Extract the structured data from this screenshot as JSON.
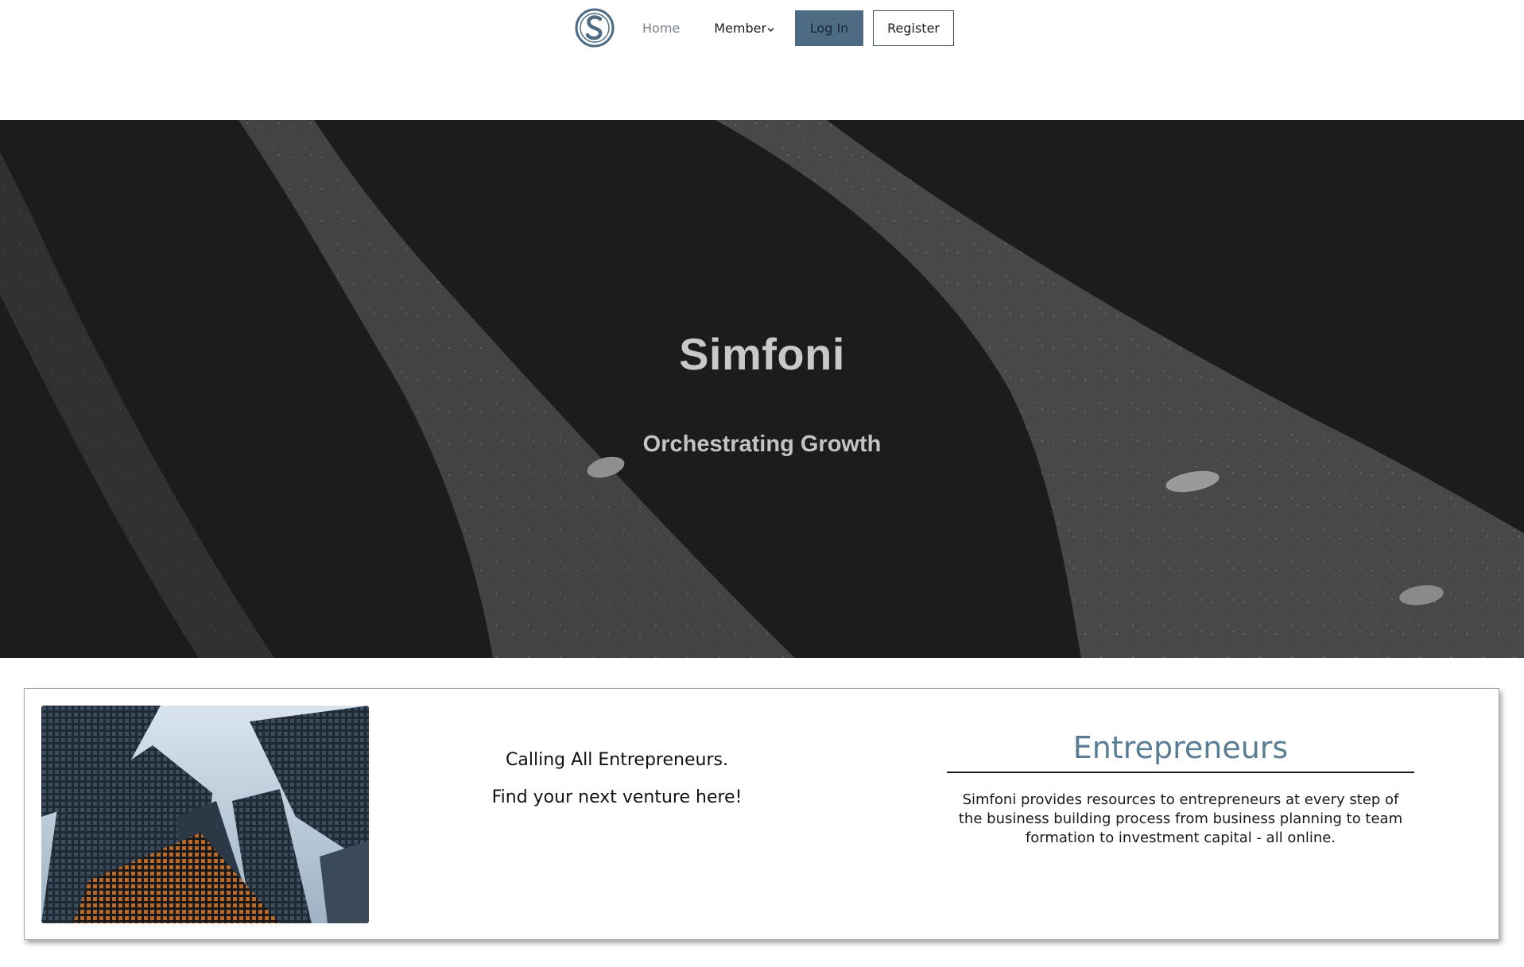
{
  "nav": {
    "logo_icon": "simfoni-s-logo",
    "home": "Home",
    "member": "Member",
    "member_icon": "chevron-down-icon",
    "login": "Log In",
    "register": "Register"
  },
  "hero": {
    "title": "Simfoni",
    "subtitle": "Orchestrating Growth"
  },
  "card": {
    "image": "skyscrapers-photo",
    "line1": "Calling All Entrepreneurs.",
    "line2": "Find your next venture here!",
    "heading": "Entrepreneurs",
    "description": "Simfoni provides resources to entrepreneurs at every step of the business building process from business planning to team formation to investment capital - all online."
  },
  "colors": {
    "accent": "#4d6c84",
    "heading": "#5b7d93",
    "hero_bg": "#1c1c1d"
  }
}
